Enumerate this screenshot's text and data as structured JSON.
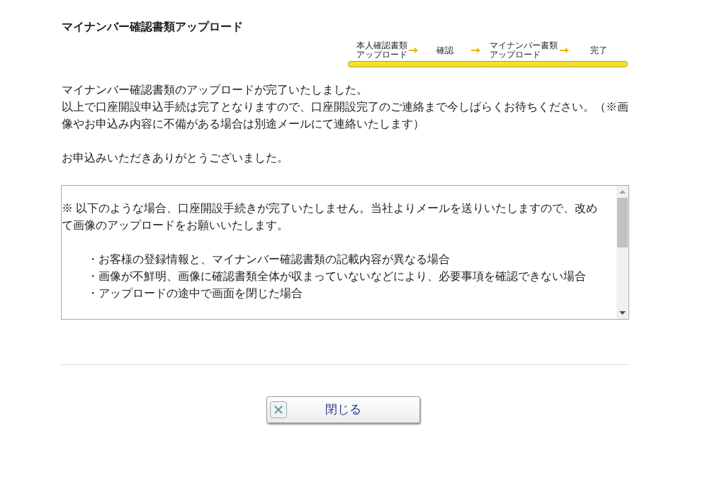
{
  "title": "マイナンバー確認書類アップロード",
  "steps": [
    {
      "label": "本人確認書類アップロード",
      "done": true
    },
    {
      "label": "確認",
      "done": true
    },
    {
      "label": "マイナンバー書類アップロード",
      "done": true
    },
    {
      "label": "完了",
      "done": true
    }
  ],
  "message": [
    "マイナンバー確認書類のアップロードが完了いたしました。",
    "以上で口座開設申込手続は完了となりますので、口座開設完了のご連絡まで今しばらくお待ちください。（※画像やお申込み内容に不備がある場合は別途メールにて連絡いたします）",
    "お申込みいただきありがとうございました。"
  ],
  "notice": {
    "intro": "※ 以下のような場合、口座開設手続きが完了いたしません。当社よりメールを送りいたしますので、改めて画像のアップロードをお願いいたします。",
    "items": [
      "・お客様の登録情報と、マイナンバー確認書類の記載内容が異なる場合",
      "・画像が不鮮明、画像に確認書類全体が収まっていないなどにより、必要事項を確認できない場合",
      "・アップロードの途中で画面を閉じた場合"
    ]
  },
  "close_button": {
    "label": "閉じる"
  }
}
